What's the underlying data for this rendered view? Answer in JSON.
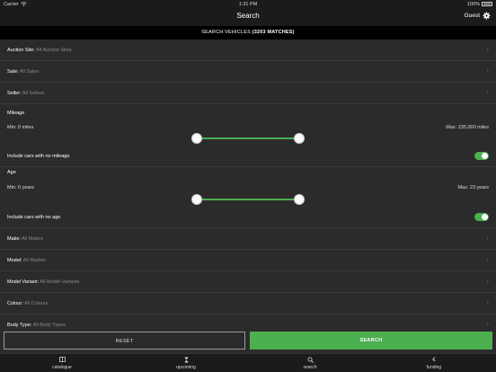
{
  "status_bar": {
    "carrier": "Carrier",
    "time": "1:31 PM",
    "battery": "100%"
  },
  "nav": {
    "title": "Search",
    "guest_label": "Guest"
  },
  "banner": {
    "prefix": "SEARCH VEHICLES",
    "count": "(3203 MATCHES)"
  },
  "filters": {
    "auction_site": {
      "label": "Auction Site:",
      "value": "All Auction Sites"
    },
    "sale": {
      "label": "Sale:",
      "value": "All Sales"
    },
    "seller": {
      "label": "Seller:",
      "value": "All Sellers"
    },
    "make": {
      "label": "Make:",
      "value": "All Makes"
    },
    "model": {
      "label": "Model:",
      "value": "All Models"
    },
    "model_variant": {
      "label": "Model Variant:",
      "value": "All Model Variants"
    },
    "colour": {
      "label": "Colour:",
      "value": "All Colours"
    },
    "body_type": {
      "label": "Body Type:",
      "value": "All Body Types"
    }
  },
  "mileage": {
    "heading": "Mileage",
    "min_label": "Min:  0 miles",
    "max_label": "Max:  235,000 miles",
    "include_label": "Include cars with no mileage",
    "include_on": true
  },
  "age": {
    "heading": "Age",
    "min_label": "Min:  0 years",
    "max_label": "Max:  23 years",
    "include_label": "Include cars with no age",
    "include_on": true
  },
  "buttons": {
    "reset": "RESET",
    "search": "SEARCH"
  },
  "tabs": [
    {
      "label": "catalogue",
      "icon": "catalogue-icon"
    },
    {
      "label": "upcoming",
      "icon": "upcoming-icon"
    },
    {
      "label": "search",
      "icon": "search-icon",
      "active": true
    },
    {
      "label": "funding",
      "icon": "funding-icon"
    }
  ],
  "colors": {
    "accent": "#4caf50",
    "background": "#2b2b2b",
    "bar": "#1b1b1b"
  }
}
